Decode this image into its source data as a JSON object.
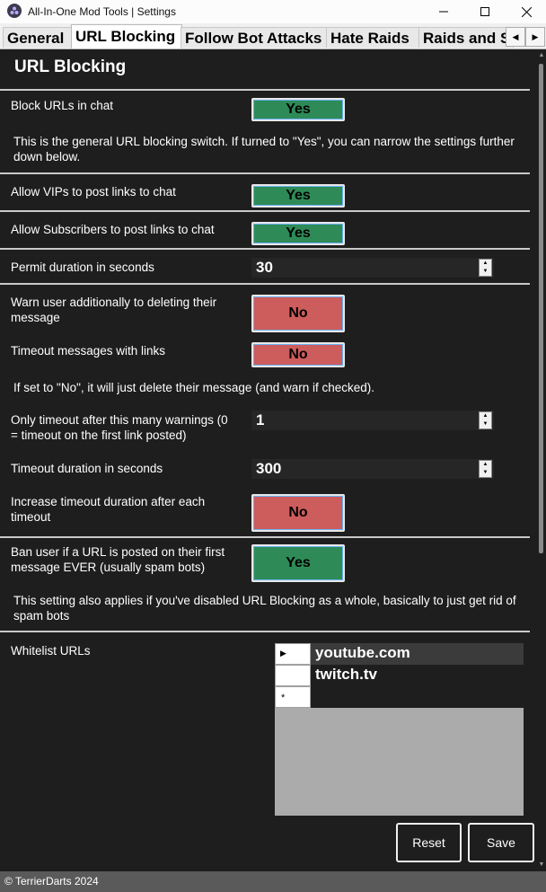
{
  "window": {
    "title": "All-In-One Mod Tools | Settings",
    "minimize_glyph": "—",
    "maximize_glyph": "☐",
    "close_glyph": "✕"
  },
  "tabs": [
    {
      "label": "General"
    },
    {
      "label": "URL Blocking"
    },
    {
      "label": "Follow Bot Attacks"
    },
    {
      "label": "Hate Raids"
    },
    {
      "label": "Raids and Spam"
    }
  ],
  "tab_scroll": {
    "left": "◀",
    "right": "▶"
  },
  "page": {
    "heading": "URL Blocking",
    "block_urls": {
      "label": "Block URLs in chat",
      "value": "Yes"
    },
    "block_urls_desc": "This is the general URL blocking switch. If turned to \"Yes\", you can narrow the settings further down below.",
    "allow_vips": {
      "label": "Allow VIPs to post links to chat",
      "value": "Yes"
    },
    "allow_subs": {
      "label": "Allow Subscribers to post links to chat",
      "value": "Yes"
    },
    "permit_duration": {
      "label": "Permit duration in seconds",
      "value": "30"
    },
    "warn_user": {
      "label": "Warn user additionally to deleting their message",
      "value": "No"
    },
    "timeout_links": {
      "label": "Timeout messages with links",
      "value": "No"
    },
    "timeout_desc": "If set to \"No\", it will just delete their message (and warn if checked).",
    "timeout_warnings": {
      "label": "Only timeout after this many warnings (0 = timeout on the first link posted)",
      "value": "1"
    },
    "timeout_duration": {
      "label": "Timeout duration in seconds",
      "value": "300"
    },
    "increase_timeout": {
      "label": "Increase timeout duration after each timeout",
      "value": "No"
    },
    "ban_first": {
      "label": "Ban user if a URL is posted on their first message EVER (usually spam bots)",
      "value": "Yes"
    },
    "ban_desc": "This setting also applies if you've disabled URL Blocking as a whole, basically to just get rid of spam bots",
    "whitelist": {
      "label": "Whitelist URLs",
      "rows": [
        "youtube.com",
        "twitch.tv"
      ],
      "current_marker": "▶",
      "new_marker": "*"
    }
  },
  "buttons": {
    "reset": "Reset",
    "save": "Save"
  },
  "spin": {
    "up": "▲",
    "down": "▼"
  },
  "status": "© TerrierDarts 2024",
  "colors": {
    "yes": "#2e8b57",
    "no": "#cd5c5c",
    "background": "#1e1e1e"
  }
}
